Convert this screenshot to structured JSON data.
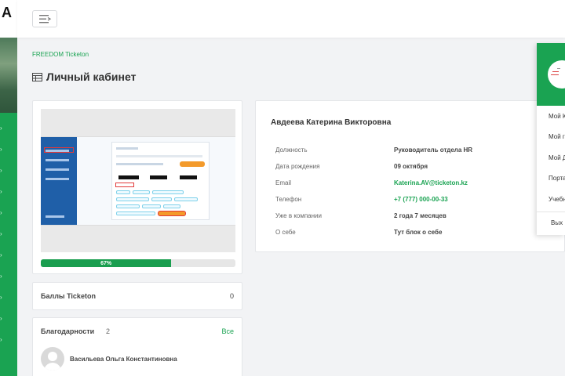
{
  "sidebar": {
    "logo_text": "A"
  },
  "breadcrumb": "FREEDOM Ticketon",
  "page_title": "Личный кабинет",
  "preview": {
    "progress_label": "67%",
    "progress_value": 0.67
  },
  "points": {
    "label": "Баллы Ticketon",
    "value": "0"
  },
  "thanks": {
    "title": "Благодарности",
    "count": "2",
    "all_link": "Все",
    "person_name": "Васильева Ольга Константиновна"
  },
  "profile": {
    "full_name": "Авдеева Катерина Викторовна",
    "rows": [
      {
        "label": "Должность",
        "value": "Руководитель отдела HR"
      },
      {
        "label": "Дата рождения",
        "value": "09 октября"
      },
      {
        "label": "Email",
        "value": "Katerina.AV@ticketon.kz"
      },
      {
        "label": "Телефон",
        "value": "+7 (777) 000-00-33"
      },
      {
        "label": "Уже в компании",
        "value": "2 года 7 месяцев"
      },
      {
        "label": "О себе",
        "value": "Тут блок о себе"
      }
    ]
  },
  "dropdown": {
    "items": [
      "Мой К",
      "Мой г",
      "Мой Д",
      "Порта",
      "Учебн"
    ],
    "logout": "Вых"
  },
  "colors": {
    "accent": "#1aa352",
    "progress": "#1a9e4f"
  }
}
